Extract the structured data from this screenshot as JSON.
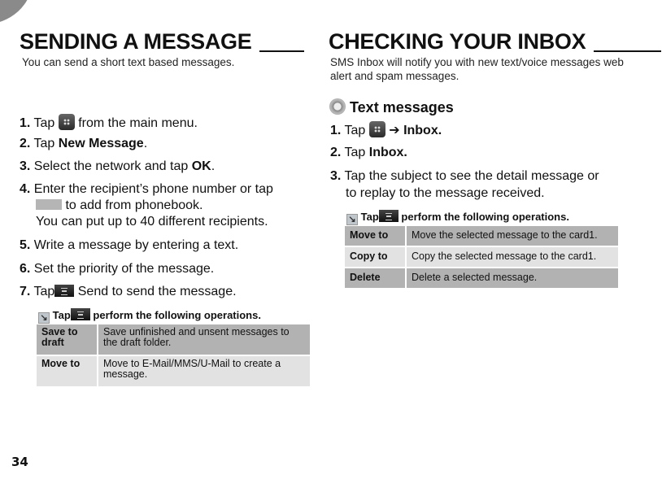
{
  "left": {
    "title": "SENDING A MESSAGE",
    "subtitle": "You can send a short text based messages.",
    "steps": [
      {
        "n": "1.",
        "pre": "Tap",
        "post": "from the main menu."
      },
      {
        "n": "2.",
        "pre": "Tap",
        "bold": "New Message",
        "post": "."
      },
      {
        "n": "3.",
        "pre": "Select the network and tap",
        "bold": "OK",
        "post": "."
      },
      {
        "n": "4.",
        "line1": "Enter the recipient’s phone number or tap",
        "line2": "to add from phonebook.",
        "line3": "You can put up to 40 different recipients."
      },
      {
        "n": "5.",
        "text": "Write a message by entering a text."
      },
      {
        "n": "6.",
        "text": "Set the priority of the message."
      },
      {
        "n": "7.",
        "pre": "Tap",
        "post": "Send to send the message."
      }
    ],
    "tip": {
      "pre": "Tap",
      "post": "perform the following operations."
    },
    "table": [
      {
        "key": "Save to draft",
        "value": "Save unfinished and unsent messages to the draft folder."
      },
      {
        "key": "Move to",
        "value": "Move to E-Mail/MMS/U-Mail to create a message."
      }
    ]
  },
  "right": {
    "title": "CHECKING YOUR INBOX",
    "subtitle_line1": "SMS Inbox will notify you with new text/voice messages web",
    "subtitle_line2": "alert and spam messages.",
    "section": "Text messages",
    "steps": [
      {
        "n": "1.",
        "pre": "Tap",
        "arrow": "➔",
        "bold": "Inbox."
      },
      {
        "n": "2.",
        "pre": "Tap",
        "bold": "Inbox."
      },
      {
        "n": "3.",
        "line1": "Tap the subject to see the detail message or",
        "line2": "to replay to the message received."
      }
    ],
    "tip": {
      "pre": "Tap",
      "post": "perform the following operations."
    },
    "table": [
      {
        "key": "Move to",
        "value": "Move the selected message to the card1."
      },
      {
        "key": "Copy to",
        "value": "Copy the selected message to the card1."
      },
      {
        "key": "Delete",
        "value": "Delete a selected message."
      }
    ]
  },
  "page_number": "34",
  "icons": {
    "menu": "main-menu-icon",
    "options": "options-menu-icon",
    "phonebook": "phonebook-button-icon",
    "tip": "tip-arrow-icon",
    "section": "messages-icon"
  }
}
